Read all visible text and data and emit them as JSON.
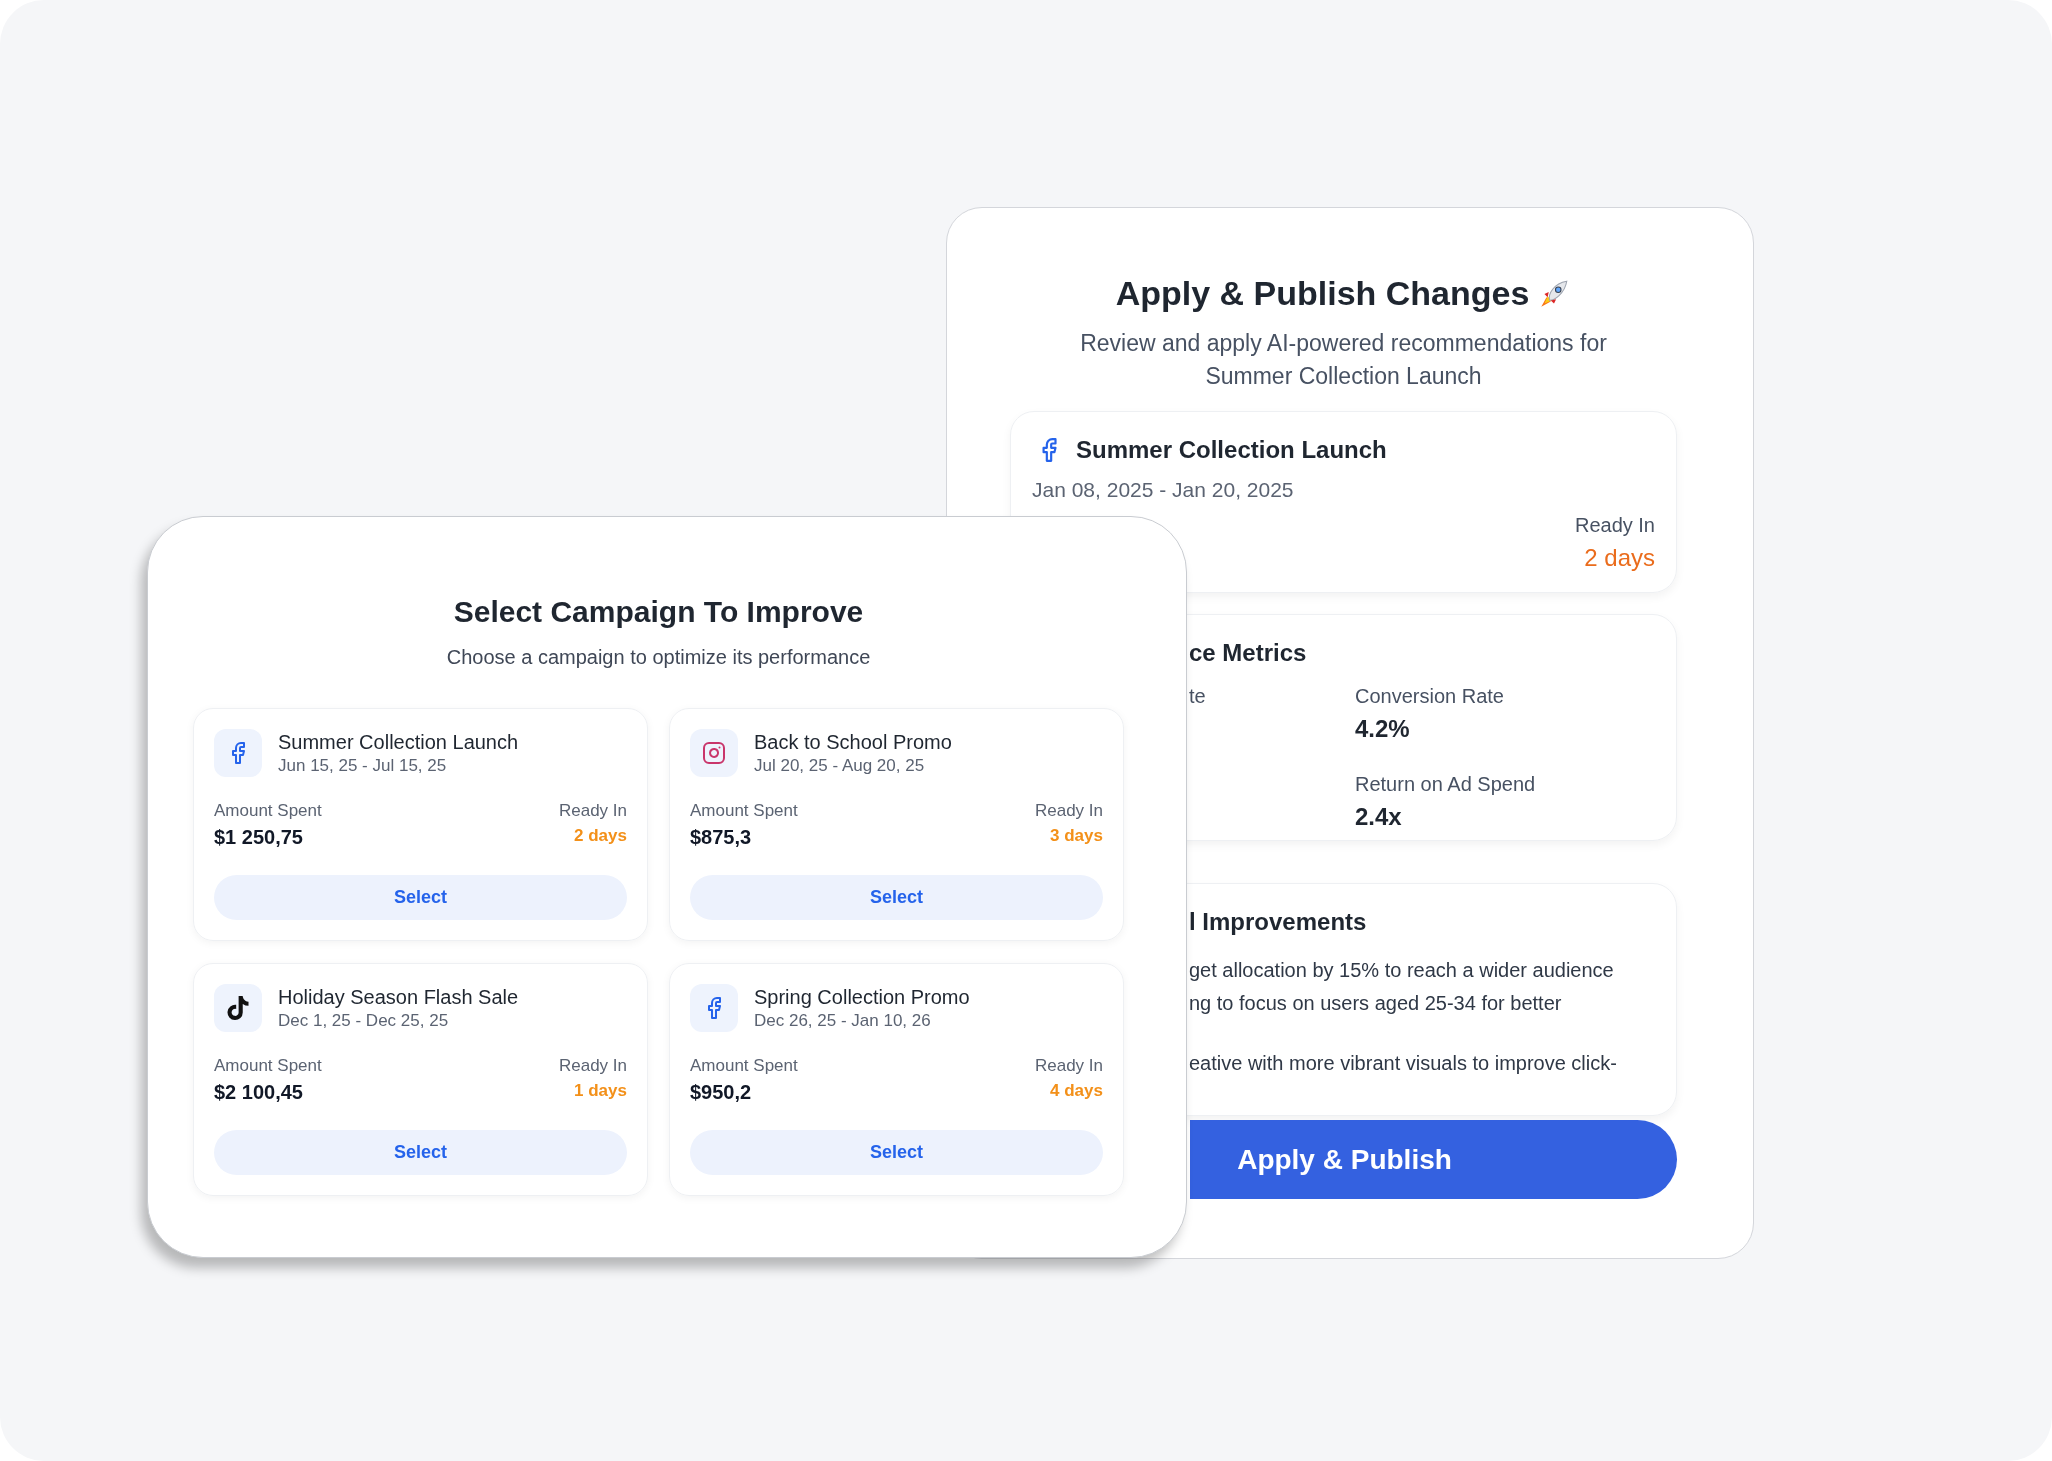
{
  "publish_panel": {
    "title": "Apply & Publish Changes",
    "subtitle": "Review and apply AI-powered recommendations for Summer Collection Launch",
    "campaign": {
      "kind": "facebook",
      "name": "Summer Collection Launch",
      "dates": "Jan 08, 2025 - Jan 20, 2025",
      "ready_label": "Ready In",
      "ready_value": "2 days"
    },
    "metrics": {
      "title": "ce Metrics",
      "column_1": [
        {
          "label": "te"
        }
      ],
      "column_2": [
        {
          "label": "Conversion Rate",
          "value": "4.2%"
        },
        {
          "label": "Return on Ad Spend",
          "value": "2.4x"
        }
      ]
    },
    "improvements": {
      "title": "l Improvements",
      "lines": [
        "get allocation by 15% to reach a wider audience",
        "ng to focus on users aged 25-34 for better",
        "eative with more vibrant visuals to improve click-"
      ]
    },
    "button": "Apply & Publish"
  },
  "select_panel": {
    "title": "Select Campaign To Improve",
    "subtitle": "Choose a campaign to optimize its performance",
    "campaigns": [
      {
        "kind": "facebook",
        "name": "Summer Collection Launch",
        "dates": "Jun 15, 25 - Jul 15, 25",
        "amount_label": "Amount Spent",
        "amount": "$1 250,75",
        "ready_label": "Ready In",
        "ready_value": "2 days",
        "button": "Select"
      },
      {
        "kind": "instagram",
        "name": "Back to School Promo",
        "dates": "Jul 20, 25 - Aug 20, 25",
        "amount_label": "Amount Spent",
        "amount": "$875,3",
        "ready_label": "Ready In",
        "ready_value": "3 days",
        "button": "Select"
      },
      {
        "kind": "tiktok",
        "name": "Holiday Season Flash Sale",
        "dates": "Dec 1, 25 - Dec 25, 25",
        "amount_label": "Amount Spent",
        "amount": "$2 100,45",
        "ready_label": "Ready In",
        "ready_value": "1 days",
        "button": "Select"
      },
      {
        "kind": "facebook",
        "name": "Spring Collection Promo",
        "dates": "Dec 26, 25 - Jan 10, 26",
        "amount_label": "Amount Spent",
        "amount": "$950,2",
        "ready_label": "Ready In",
        "ready_value": "4 days",
        "button": "Select"
      }
    ]
  }
}
